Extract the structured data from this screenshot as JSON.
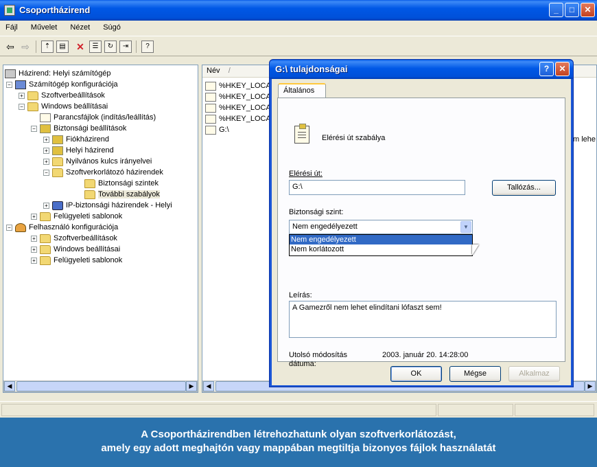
{
  "main_window": {
    "title": "Csoportházirend",
    "menu": [
      "Fájl",
      "Művelet",
      "Nézet",
      "Súgó"
    ]
  },
  "tree": {
    "items": [
      {
        "label": "Házirend: Helyi számítógép"
      },
      {
        "label": "Számítógép konfigurációja"
      },
      {
        "label": "Szoftverbeállítások"
      },
      {
        "label": "Windows beállításai"
      },
      {
        "label": "Parancsfájlok (indítás/leállítás)"
      },
      {
        "label": "Biztonsági beállítások"
      },
      {
        "label": "Fiókházirend"
      },
      {
        "label": "Helyi házirend"
      },
      {
        "label": "Nyilvános kulcs irányelvei"
      },
      {
        "label": "Szoftverkorlátozó házirendek"
      },
      {
        "label": "Biztonsági szintek"
      },
      {
        "label": "További szabályok"
      },
      {
        "label": "IP-biztonsági házirendek - Helyi"
      },
      {
        "label": "Felügyeleti sablonok"
      },
      {
        "label": "Felhasználó konfigurációja"
      },
      {
        "label": "Szoftverbeállítások"
      },
      {
        "label": "Windows beállításai"
      },
      {
        "label": "Felügyeleti sablonok"
      }
    ]
  },
  "list": {
    "column_name": "Név",
    "sort_indicator": "/",
    "rows": [
      "%HKEY_LOCAL",
      "%HKEY_LOCAL",
      "%HKEY_LOCAL",
      "%HKEY_LOCAL",
      "G:\\"
    ],
    "partial_text": "m lehe"
  },
  "dialog": {
    "title": "G:\\ tulajdonságai",
    "help_button": "?",
    "tab": "Általános",
    "rule_type": "Elérési út szabálya",
    "path_label": "Elérési út:",
    "path_value": "G:\\",
    "browse_button": "Tallózás...",
    "security_level_label": "Biztonsági szint:",
    "security_level_value": "Nem engedélyezett",
    "security_options": [
      "Nem engedélyezett",
      "Nem korlátozott"
    ],
    "description_label": "Leírás:",
    "description_value": "A Gamezről nem lehet elindítani lófaszt sem!",
    "modified_label_line1": "Utolsó módosítás",
    "modified_label_line2": "dátuma:",
    "modified_value": "2003. január 20.  14:28:00",
    "ok_button": "OK",
    "cancel_button": "Mégse",
    "apply_button": "Alkalmaz"
  },
  "caption": {
    "line1": "A Csoportházirendben létrehozhatunk olyan szoftverkorlátozást,",
    "line2": "amely egy adott meghajtón vagy mappában megtiltja bizonyos fájlok használatát"
  }
}
